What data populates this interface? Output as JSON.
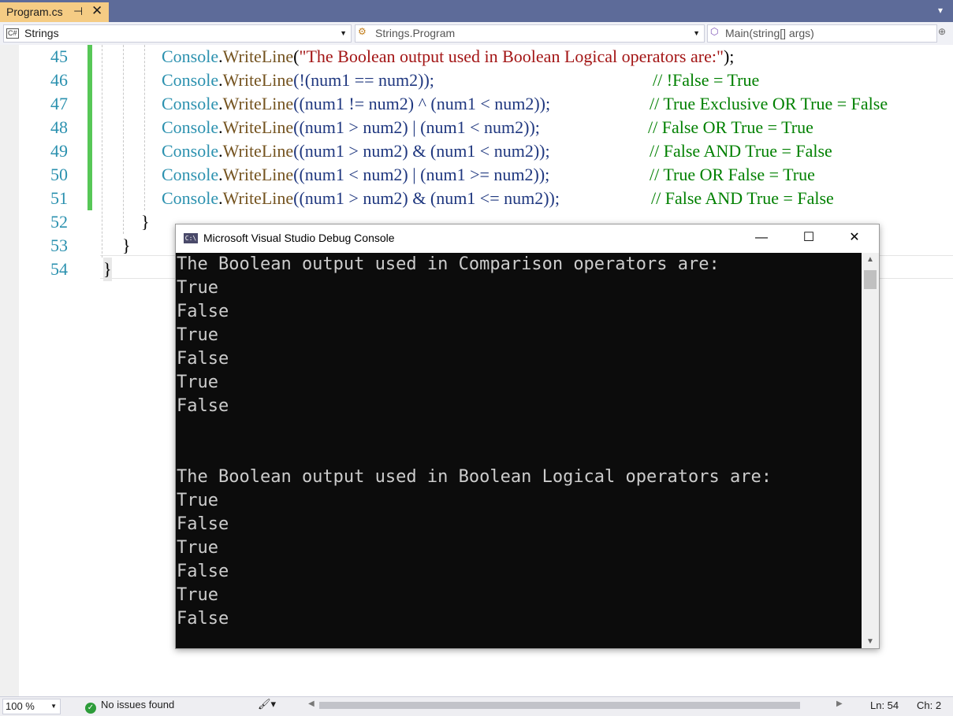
{
  "tab": {
    "filename": "Program.cs",
    "pin_glyph": "⊣",
    "close_glyph": "✕"
  },
  "navbar": {
    "project": {
      "icon_text": "C#",
      "label": "Strings"
    },
    "type": {
      "label": "Strings.Program"
    },
    "member": {
      "label": "Main(string[] args)"
    }
  },
  "editor": {
    "line_numbers": [
      "45",
      "46",
      "47",
      "48",
      "49",
      "50",
      "51",
      "52",
      "53",
      "54"
    ],
    "lines": [
      {
        "obj": "Console",
        "method": "WriteLine",
        "args_pre": "(",
        "string": "\"The Boolean output used in Boolean Logical operators are:\"",
        "args_post": ");",
        "comment": ""
      },
      {
        "obj": "Console",
        "method": "WriteLine",
        "args": "(!(num1 == num2));",
        "comment": "// !False = True"
      },
      {
        "obj": "Console",
        "method": "WriteLine",
        "args": "((num1 != num2) ^ (num1 < num2));",
        "comment": "// True Exclusive OR True = False"
      },
      {
        "obj": "Console",
        "method": "WriteLine",
        "args": "((num1 > num2) | (num1 < num2));",
        "comment": "// False OR True = True"
      },
      {
        "obj": "Console",
        "method": "WriteLine",
        "args": "((num1 > num2) & (num1 < num2));",
        "comment": "// False AND True = False"
      },
      {
        "obj": "Console",
        "method": "WriteLine",
        "args": "((num1 < num2) | (num1 >= num2));",
        "comment": "// True OR False = True"
      },
      {
        "obj": "Console",
        "method": "WriteLine",
        "args": "((num1 > num2) & (num1 <= num2));",
        "comment": "// False AND True = False"
      }
    ],
    "braces": [
      "}",
      "}",
      "}"
    ]
  },
  "console": {
    "icon_text": "C:\\",
    "title": "Microsoft Visual Studio Debug Console",
    "minimize_glyph": "—",
    "maximize_glyph": "☐",
    "close_glyph": "✕",
    "output": [
      "The Boolean output used in Comparison operators are:",
      "True",
      "False",
      "True",
      "False",
      "True",
      "False",
      "",
      "",
      "The Boolean output used in Boolean Logical operators are:",
      "True",
      "False",
      "True",
      "False",
      "True",
      "False"
    ]
  },
  "status": {
    "zoom": "100 %",
    "issues": "No issues found",
    "line": "Ln: 54",
    "col": "Ch: 2"
  },
  "colors": {
    "keyword_class": "#2b91af",
    "method": "#74531f",
    "string": "#a31515",
    "comment": "#008000",
    "line_number": "#2b91af",
    "tab_active": "#f5cc84"
  }
}
